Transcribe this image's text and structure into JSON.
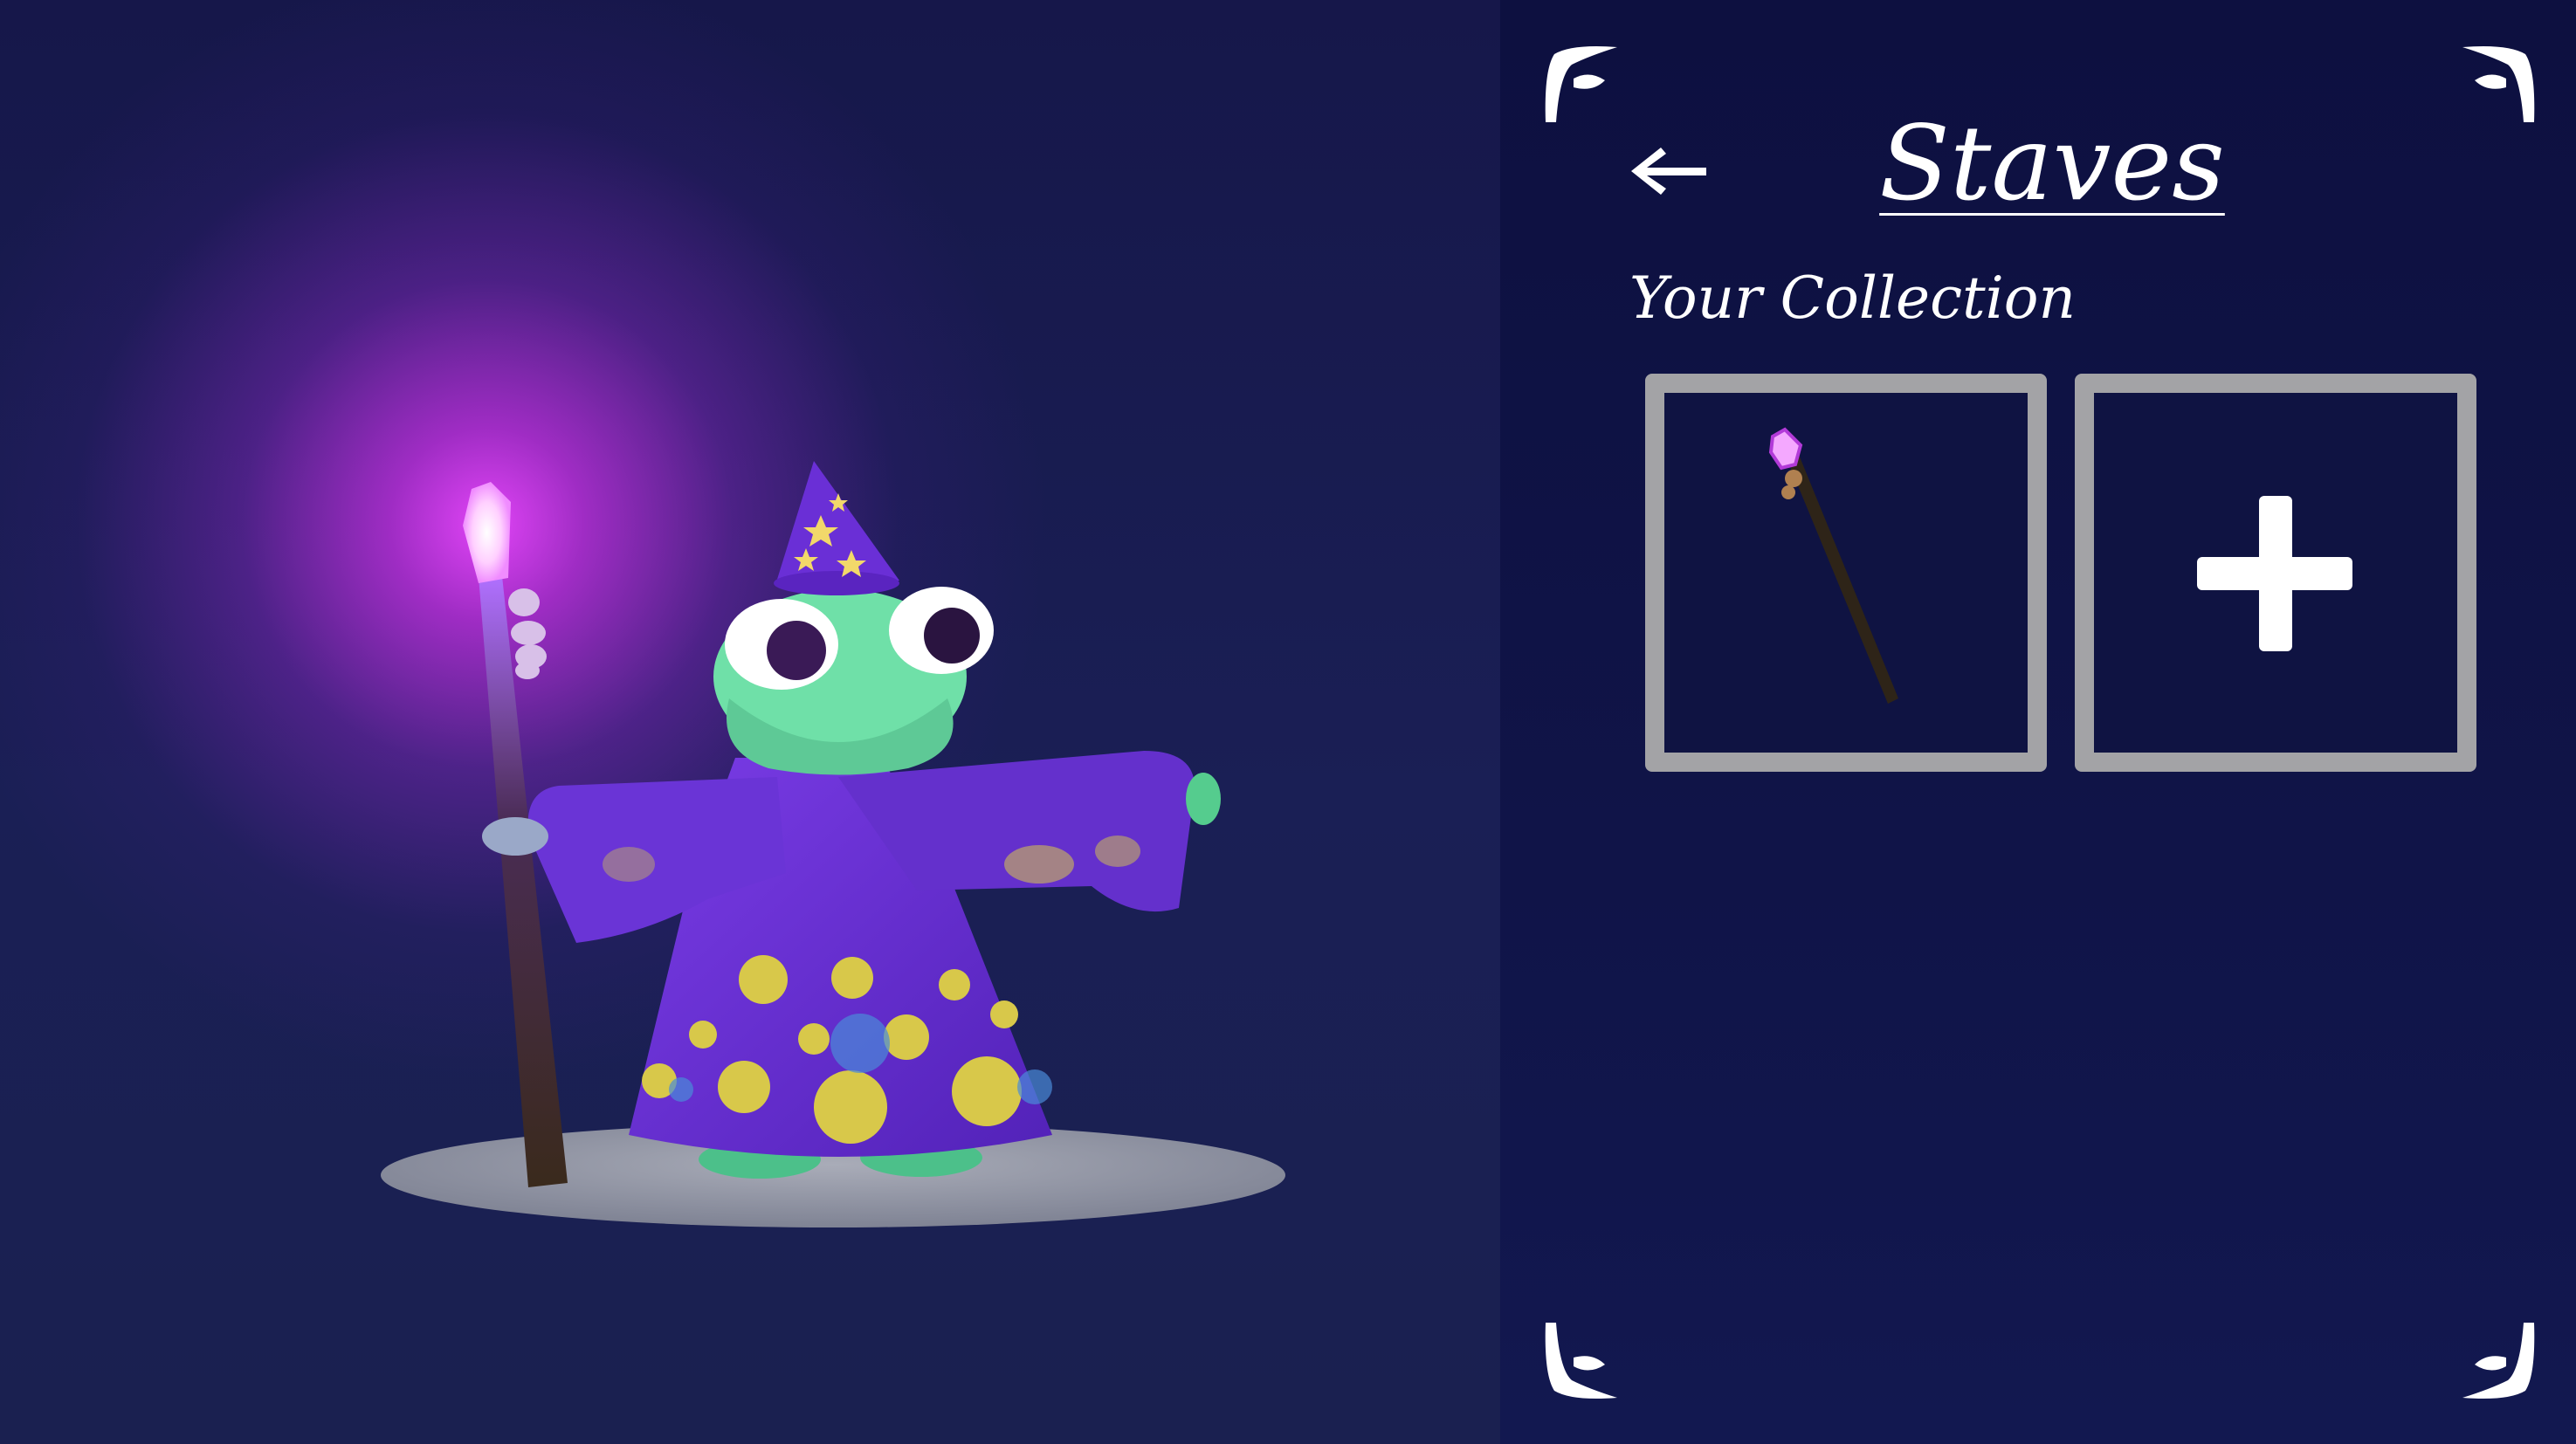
{
  "scene": {
    "character": "frog-wizard",
    "accent_glow_color": "#e64cff",
    "robe_color": "#6a2fd6",
    "skin_color": "#6fe0a8"
  },
  "panel": {
    "title": "Staves",
    "subtitle": "Your Collection",
    "back_icon": "arrow-left-icon",
    "slots": [
      {
        "type": "item",
        "icon": "crystal-staff-icon"
      },
      {
        "type": "add",
        "icon": "plus-icon"
      }
    ],
    "colors": {
      "panel_bg": "#0d1040",
      "slot_border": "#a3a3a6",
      "text": "#ffffff"
    }
  }
}
